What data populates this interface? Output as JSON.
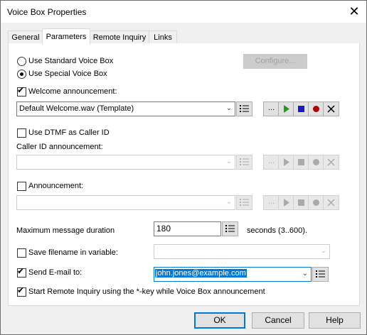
{
  "window": {
    "title": "Voice Box Properties"
  },
  "tabs": [
    {
      "label": "General"
    },
    {
      "label": "Parameters"
    },
    {
      "label": "Remote Inquiry"
    },
    {
      "label": "Links"
    }
  ],
  "voice_box": {
    "standard_label": "Use Standard Voice Box",
    "special_label": "Use Special Voice Box",
    "selected": "special",
    "configure_label": "Configure..."
  },
  "welcome": {
    "label": "Welcome announcement:",
    "checked": true,
    "value": "Default Welcome.wav (Template)"
  },
  "dtmf": {
    "label": "Use DTMF as Caller ID",
    "checked": false
  },
  "caller_id": {
    "label": "Caller ID announcement:",
    "value": ""
  },
  "announcement": {
    "label": "Announcement:",
    "checked": false,
    "value": ""
  },
  "max_duration": {
    "label": "Maximum message duration",
    "value": "180",
    "unit": "seconds (3..600)."
  },
  "save_filename": {
    "label": "Save filename in variable:",
    "checked": false,
    "value": ""
  },
  "send_email": {
    "label": "Send E-mail to:",
    "checked": true,
    "value": "john.jones@example.com"
  },
  "remote_inquiry": {
    "label": "Start Remote Inquiry using the *-key while Voice Box announcement",
    "checked": true
  },
  "media_buttons": {
    "browse": "...",
    "play": "play-icon",
    "stop": "stop-icon",
    "record": "record-icon",
    "delete": "delete-icon"
  },
  "footer": {
    "ok": "OK",
    "cancel": "Cancel",
    "help": "Help"
  },
  "colors": {
    "accent": "#0078d7",
    "play": "#1f9b1f",
    "stop": "#1a1ac8",
    "record": "#b00000"
  }
}
